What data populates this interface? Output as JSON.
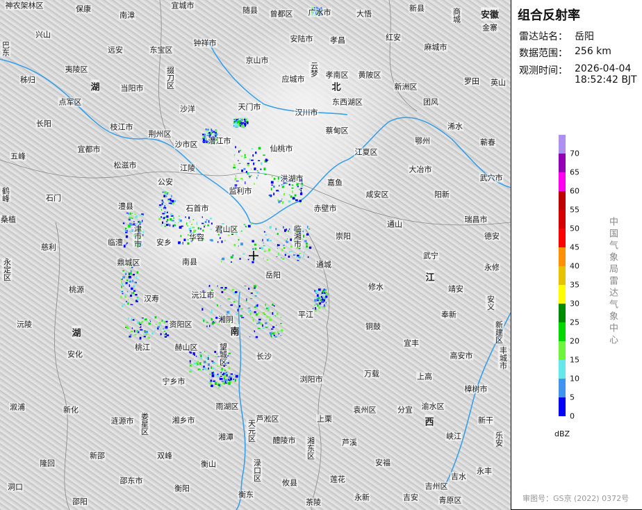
{
  "panel": {
    "title": "组合反射率",
    "station_label": "雷达站名：",
    "station_value": "岳阳",
    "range_label": "数据范围：",
    "range_value": "256 km",
    "time_label": "观测时间：",
    "time_date": "2026-04-04",
    "time_clock": "18:52:42 BJT",
    "agency": "中国气象局雷达气象中心",
    "approval": "审图号：GS京 (2022) 0372号"
  },
  "legend": {
    "unit": "dBZ",
    "labels": [
      "70",
      "65",
      "60",
      "55",
      "50",
      "45",
      "40",
      "35",
      "30",
      "25",
      "20",
      "15",
      "10",
      "5",
      "0"
    ],
    "colors": [
      "#ad90f0",
      "#9600b4",
      "#ff00f0",
      "#c00000",
      "#d60000",
      "#ff0000",
      "#ff9000",
      "#e7c000",
      "#ffff00",
      "#008c00",
      "#00d800",
      "#6cf53c",
      "#66e8e8",
      "#4094f0",
      "#0000f6"
    ]
  },
  "provinces": [
    "湖",
    "北",
    "湖",
    "南",
    "江",
    "西",
    "安徽"
  ],
  "places": [
    "神农架林区",
    "保康",
    "南漳",
    "宜城市",
    "随县",
    "曾都区",
    "广水市",
    "大悟",
    "新县",
    "商城",
    "金寨",
    "兴山",
    "钟祥市",
    "安陆市",
    "孝昌",
    "红安",
    "远安",
    "东宝区",
    "京山市",
    "麻城市",
    "巴东",
    "夷陵区",
    "掇刀区",
    "应城市",
    "云梦",
    "孝南区",
    "黄陂区",
    "罗田",
    "秭归",
    "当阳市",
    "新洲区",
    "英山",
    "点军区",
    "沙洋",
    "天门市",
    "汉川市",
    "东西湖区",
    "团风",
    "长阳",
    "枝江市",
    "荆州区",
    "蔡甸区",
    "浠水",
    "五峰",
    "宜都市",
    "沙市区",
    "潜江市",
    "仙桃市",
    "江夏区",
    "鄂州",
    "蕲春",
    "松滋市",
    "江陵",
    "洪湖市",
    "嘉鱼",
    "大冶市",
    "武穴市",
    "公安",
    "监利市",
    "咸安区",
    "阳新",
    "鹤峰",
    "石门",
    "澧县",
    "石首市",
    "赤壁市",
    "瑞昌市",
    "桑植",
    "津市市",
    "君山区",
    "临湘市",
    "通山",
    "崇阳",
    "德安",
    "慈利",
    "临澧",
    "安乡",
    "华容",
    "武宁",
    "永修",
    "永定区",
    "鼎城区",
    "南县",
    "通城",
    "岳阳",
    "修水",
    "靖安",
    "桃源",
    "沅江市",
    "汉寿",
    "平江",
    "奉新",
    "安义",
    "沅陵",
    "资阳区",
    "湘阴",
    "铜鼓",
    "新建区",
    "宜丰",
    "桃江",
    "赫山区",
    "望城区",
    "长沙",
    "安化",
    "高安市",
    "丰城市",
    "万载",
    "上高",
    "宁乡市",
    "浏阳市",
    "雨湖区",
    "樟树市",
    "溆浦",
    "新化",
    "袁州区",
    "分宜",
    "渝水区",
    "涟源市",
    "娄星区",
    "湘乡市",
    "芦淞区",
    "天元区",
    "上栗",
    "新干",
    "湘潭",
    "醴陵市",
    "湘东区",
    "芦溪",
    "峡江",
    "乐安",
    "隆回",
    "新邵",
    "双峰",
    "衡山",
    "渌口区",
    "安福",
    "洞口",
    "邵东市",
    "衡阳",
    "攸县",
    "莲花",
    "吉州区",
    "吉水",
    "永丰",
    "邵阳",
    "衡东",
    "茶陵",
    "永新",
    "吉安",
    "青原区"
  ]
}
